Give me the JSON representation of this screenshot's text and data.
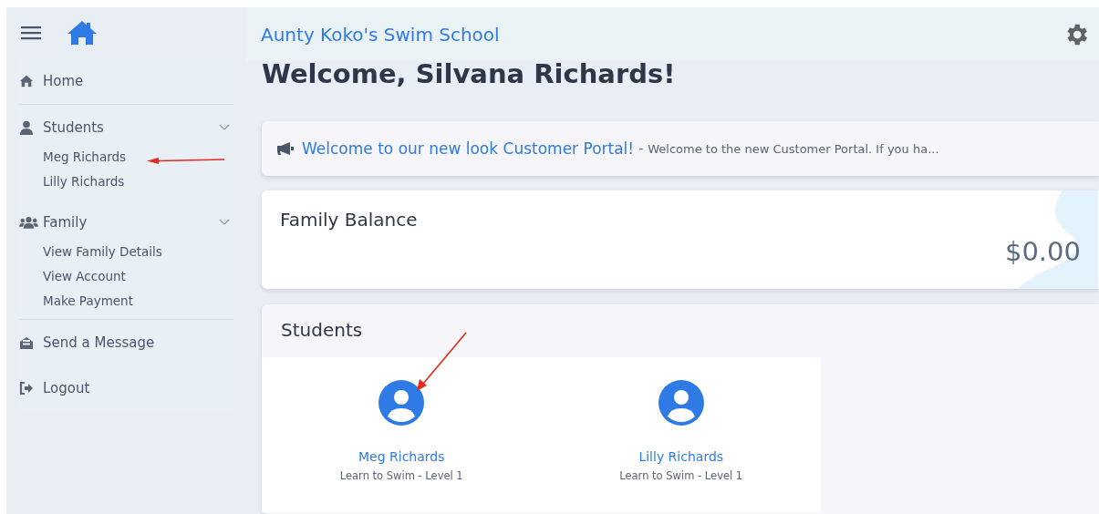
{
  "app": {
    "title": "Aunty Koko's Swim School"
  },
  "sidebar": {
    "items": [
      {
        "label": "Home"
      },
      {
        "label": "Students",
        "expanded": true,
        "children": [
          {
            "label": "Meg Richards"
          },
          {
            "label": "Lilly Richards"
          }
        ]
      },
      {
        "label": "Family",
        "expanded": true,
        "children": [
          {
            "label": "View Family Details"
          },
          {
            "label": "View Account"
          },
          {
            "label": "Make Payment"
          }
        ]
      },
      {
        "label": "Send a Message"
      },
      {
        "label": "Logout"
      }
    ]
  },
  "welcome": "Welcome, Silvana Richards!",
  "announcement": {
    "title": "Welcome to our new look Customer Portal!",
    "separator": "-",
    "text": "Welcome to the new Customer Portal. If you ha..."
  },
  "balance": {
    "title": "Family Balance",
    "amount": "$0.00"
  },
  "students": {
    "title": "Students",
    "items": [
      {
        "name": "Meg Richards",
        "course": "Learn to Swim - Level 1"
      },
      {
        "name": "Lilly Richards",
        "course": "Learn to Swim - Level 1"
      }
    ]
  }
}
